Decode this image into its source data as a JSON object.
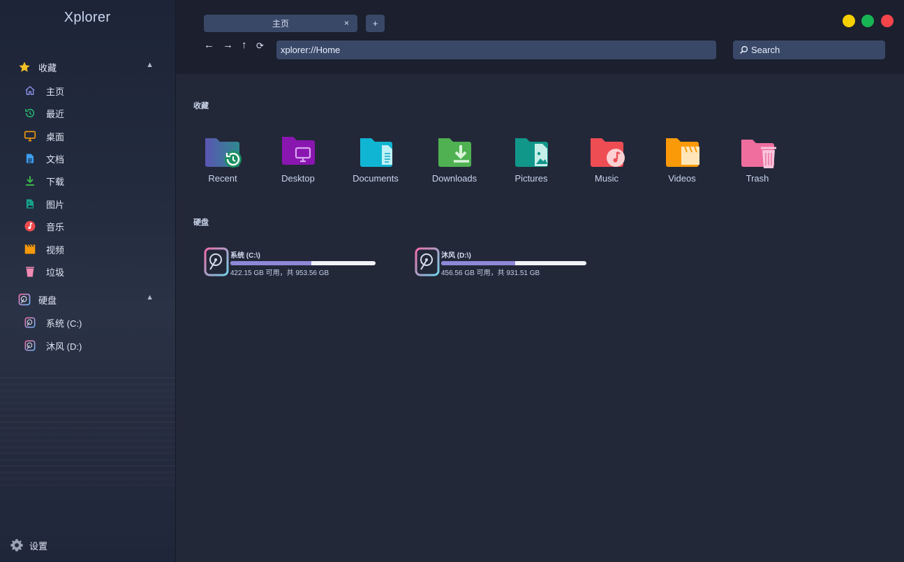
{
  "app": {
    "title": "Xplorer"
  },
  "sidebar": {
    "favorites": {
      "label": "收藏",
      "items": [
        {
          "label": "主页",
          "icon": "home-icon"
        },
        {
          "label": "最近",
          "icon": "recent-icon"
        },
        {
          "label": "桌面",
          "icon": "desktop-icon"
        },
        {
          "label": "文档",
          "icon": "document-icon"
        },
        {
          "label": "下载",
          "icon": "download-icon"
        },
        {
          "label": "图片",
          "icon": "picture-icon"
        },
        {
          "label": "音乐",
          "icon": "music-icon"
        },
        {
          "label": "视频",
          "icon": "video-icon"
        },
        {
          "label": "垃圾",
          "icon": "trash-icon"
        }
      ]
    },
    "drives": {
      "label": "硬盘",
      "items": [
        {
          "label": "系统 (C:)",
          "icon": "drive-icon"
        },
        {
          "label": "沐风 (D:)",
          "icon": "drive-icon"
        }
      ]
    },
    "settings_label": "设置"
  },
  "topbar": {
    "tab_label": "主页",
    "tab_close": "×",
    "new_tab": "+",
    "back": "←",
    "forward": "→",
    "up": "↑",
    "refresh": "⟳",
    "address_value": "xplorer://Home",
    "search_placeholder": "Search"
  },
  "window_controls": {
    "minimize_color": "#f5d000",
    "maximize_color": "#18b555",
    "close_color": "#f4454b"
  },
  "main": {
    "favorites_heading": "收藏",
    "favorites": [
      {
        "label": "Recent",
        "icon": "recent-folder-icon",
        "color": "#4f5fa6"
      },
      {
        "label": "Desktop",
        "icon": "desktop-folder-icon",
        "color": "#8a16b0"
      },
      {
        "label": "Documents",
        "icon": "documents-folder-icon",
        "color": "#11b5d4"
      },
      {
        "label": "Downloads",
        "icon": "downloads-folder-icon",
        "color": "#4fb152"
      },
      {
        "label": "Pictures",
        "icon": "pictures-folder-icon",
        "color": "#11968a"
      },
      {
        "label": "Music",
        "icon": "music-folder-icon",
        "color": "#ee4d54"
      },
      {
        "label": "Videos",
        "icon": "videos-folder-icon",
        "color": "#fb9a08"
      },
      {
        "label": "Trash",
        "icon": "trash-folder-icon",
        "color": "#ef6e9e"
      }
    ],
    "drives_heading": "硬盘",
    "drives": [
      {
        "name": "系统 (C:\\)",
        "info": "422.15 GB 可用，共 953.56 GB",
        "used_fraction": 0.557
      },
      {
        "name": "沐风 (D:\\)",
        "info": "456.56 GB 可用，共 931.51 GB",
        "used_fraction": 0.51
      }
    ]
  }
}
